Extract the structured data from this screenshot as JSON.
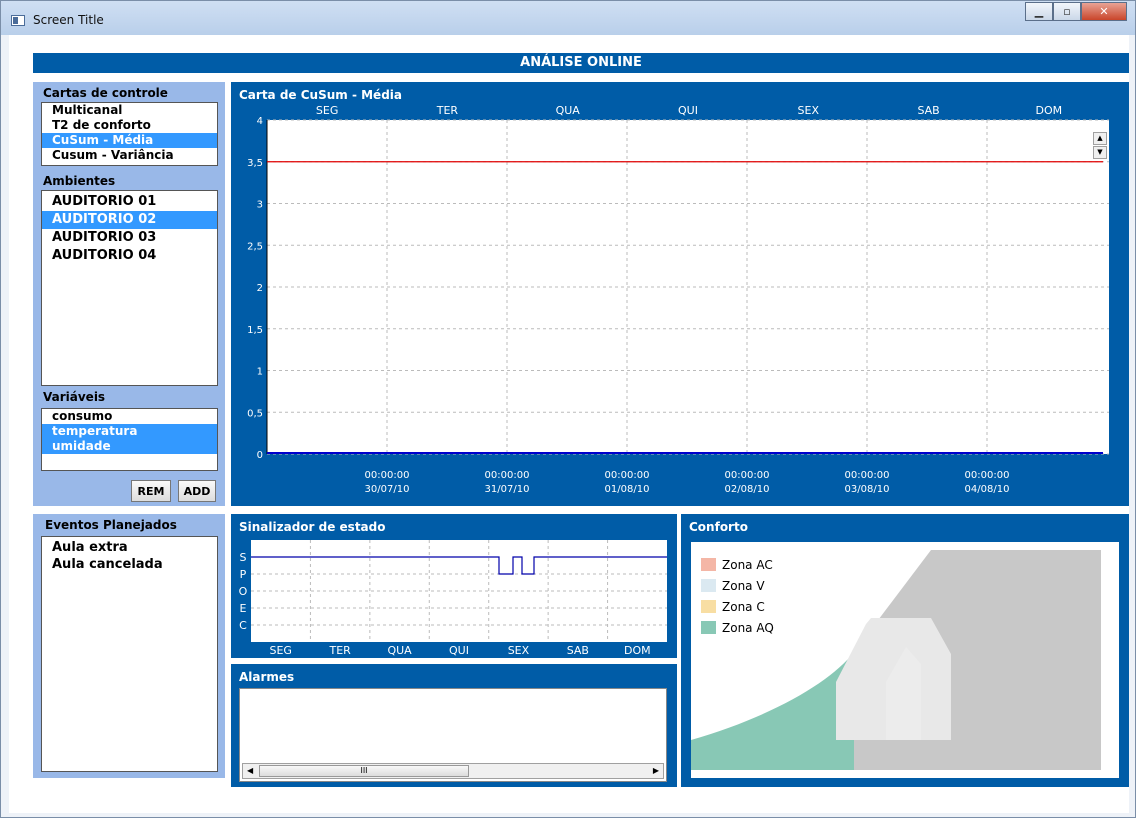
{
  "window": {
    "title": "Screen Title"
  },
  "header": {
    "title": "ANÁLISE ONLINE"
  },
  "left": {
    "charts_title": "Cartas de controle",
    "charts": [
      {
        "label": "Multicanal",
        "selected": false
      },
      {
        "label": "T2 de conforto",
        "selected": false
      },
      {
        "label": "CuSum - Média",
        "selected": true
      },
      {
        "label": "Cusum - Variância",
        "selected": false
      }
    ],
    "envs_title": "Ambientes",
    "envs": [
      {
        "label": "AUDITORIO 01",
        "selected": false
      },
      {
        "label": "AUDITORIO 02",
        "selected": true
      },
      {
        "label": "AUDITORIO 03",
        "selected": false
      },
      {
        "label": "AUDITORIO 04",
        "selected": false
      }
    ],
    "vars_title": "Variáveis",
    "vars": [
      {
        "label": "consumo",
        "selected": false
      },
      {
        "label": "temperatura",
        "selected": true
      },
      {
        "label": "umidade",
        "selected": true
      }
    ],
    "rem_label": "REM",
    "add_label": "ADD",
    "events_title": "Eventos Planejados",
    "events": [
      "Aula extra",
      "Aula cancelada"
    ]
  },
  "cusum": {
    "title": "Carta de CuSum - Média",
    "days": [
      "SEG",
      "TER",
      "QUA",
      "QUI",
      "SEX",
      "SAB",
      "DOM"
    ],
    "y_ticks": [
      "0",
      "0,5",
      "1",
      "1,5",
      "2",
      "2,5",
      "3",
      "3,5",
      "4"
    ],
    "x_times": [
      "00:00:00",
      "00:00:00",
      "00:00:00",
      "00:00:00",
      "00:00:00",
      "00:00:00"
    ],
    "x_dates": [
      "30/07/10",
      "31/07/10",
      "01/08/10",
      "02/08/10",
      "03/08/10",
      "04/08/10"
    ],
    "limit_value": 3.5,
    "limit_color": "#e00000",
    "series_color": "#0000cc",
    "ylim": [
      0,
      4
    ]
  },
  "status": {
    "title": "Sinalizador de estado",
    "levels": [
      "S",
      "P",
      "O",
      "E",
      "C"
    ],
    "days": [
      "SEG",
      "TER",
      "QUA",
      "QUI",
      "SEX",
      "SAB",
      "DOM"
    ]
  },
  "alarms": {
    "title": "Alarmes",
    "scroll_mark": "III"
  },
  "comfort": {
    "title": "Conforto",
    "legend": [
      {
        "label": "Zona AC",
        "color": "#f4b6a6"
      },
      {
        "label": "Zona V",
        "color": "#dbe9f1"
      },
      {
        "label": "Zona C",
        "color": "#f8dea3"
      },
      {
        "label": "Zona AQ",
        "color": "#88c8b5"
      }
    ]
  }
}
